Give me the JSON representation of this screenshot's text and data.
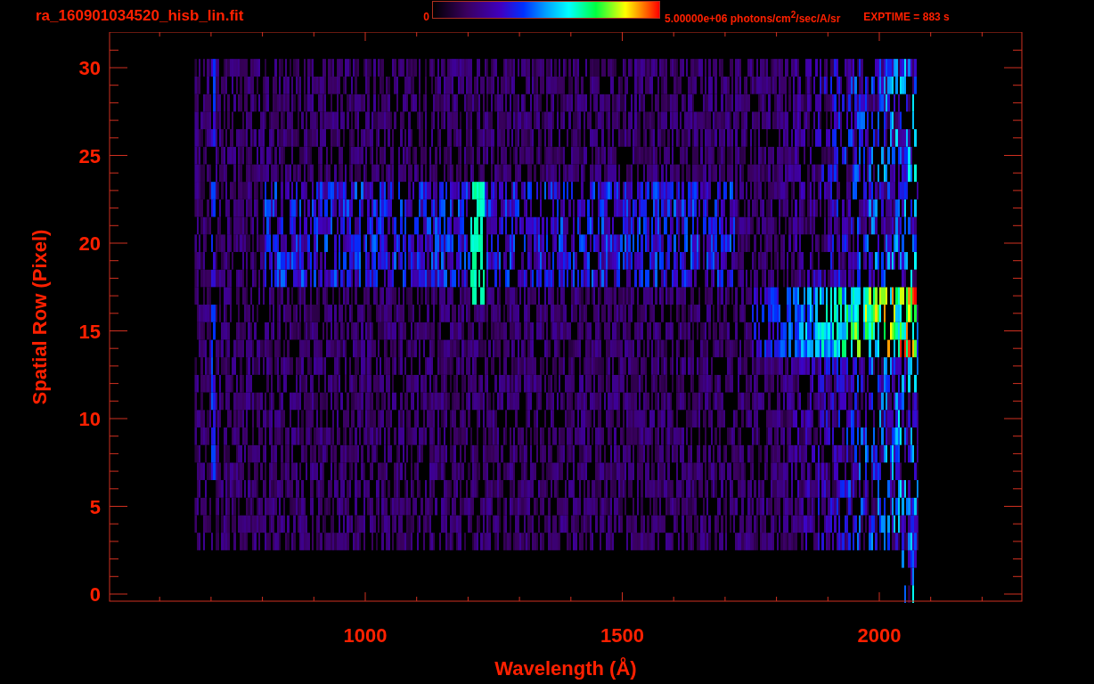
{
  "header": {
    "title": "ra_160901034520_hisb_lin.fit",
    "colorbar_min": "0",
    "colorbar_max": "5.00000e+06 photons/cm$^{2}$/sec/A/sr",
    "exptime": "EXPTIME = 883 s"
  },
  "plot": {
    "xlabel": "Wavelength (Å)",
    "ylabel": "Spatial Row (Pixel)",
    "xtick_labels": [
      "1000",
      "1500",
      "2000"
    ],
    "ytick_labels": [
      "30",
      "25",
      "20",
      "15",
      "10",
      "5",
      "0"
    ]
  }
}
